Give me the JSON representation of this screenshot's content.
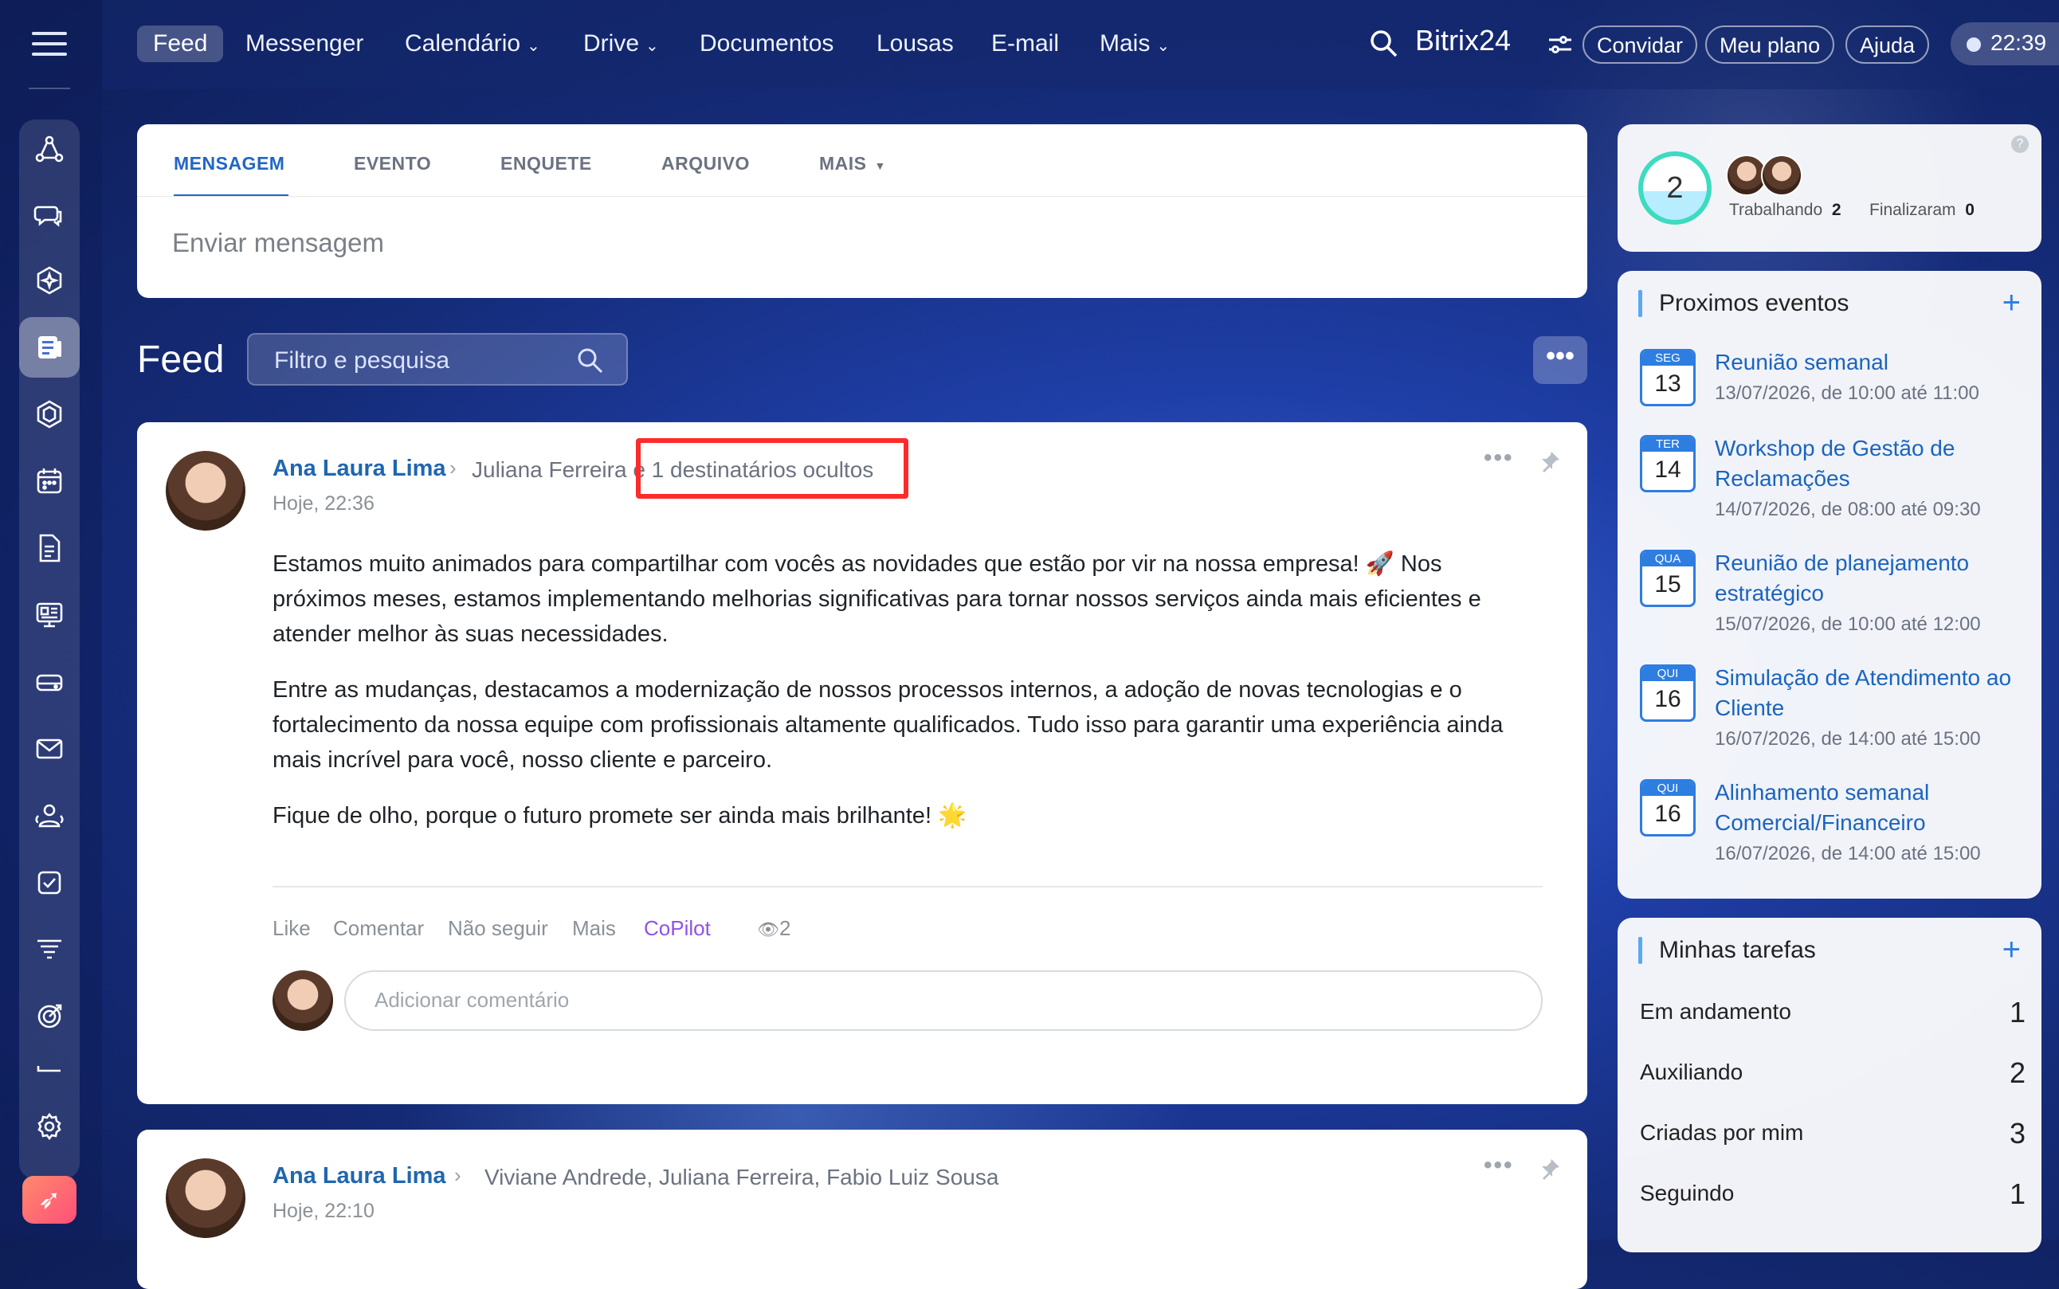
{
  "topbar": {
    "nav": [
      {
        "label": "Feed",
        "has_caret": false
      },
      {
        "label": "Messenger",
        "has_caret": false
      },
      {
        "label": "Calendário",
        "has_caret": true
      },
      {
        "label": "Drive",
        "has_caret": true
      },
      {
        "label": "Documentos",
        "has_caret": false
      },
      {
        "label": "Lousas",
        "has_caret": false
      },
      {
        "label": "E-mail",
        "has_caret": false
      },
      {
        "label": "Mais",
        "has_caret": true
      }
    ],
    "brand": "Bitrix24",
    "invite_label": "Convidar",
    "plan_label": "Meu plano",
    "help_label": "Ajuda",
    "clock": "22:39"
  },
  "composer": {
    "tabs": [
      "MENSAGEM",
      "EVENTO",
      "ENQUETE",
      "ARQUIVO",
      "MAIS"
    ],
    "active_tab": "MENSAGEM",
    "placeholder": "Enviar mensagem"
  },
  "feed": {
    "title": "Feed",
    "search_placeholder": "Filtro e pesquisa",
    "more_label": "•••"
  },
  "posts": [
    {
      "author": "Ana Laura Lima",
      "recipients": "Juliana Ferreira",
      "recipients_tail": "e",
      "hidden_recipients": "1 destinatários ocultos",
      "time": "Hoje, 22:36",
      "paragraphs": [
        "Estamos muito animados para compartilhar com vocês as novidades que estão por vir na nossa empresa! 🚀 Nos próximos meses, estamos implementando melhorias significativas para tornar nossos serviços ainda mais eficientes e atender melhor às suas necessidades.",
        "Entre as mudanças, destacamos a modernização de nossos processos internos, a adoção de novas tecnologias e o fortalecimento da nossa equipe com profissionais altamente qualificados. Tudo isso para garantir uma experiência ainda mais incrível para você, nosso cliente e parceiro.",
        "Fique de olho, porque o futuro promete ser ainda mais brilhante! 🌟"
      ],
      "actions": [
        "Like",
        "Comentar",
        "Não seguir",
        "Mais",
        "CoPilot"
      ],
      "views": "2",
      "comment_placeholder": "Adicionar comentário"
    },
    {
      "author": "Ana Laura Lima",
      "recipients": "Viviane Andrede, Juliana Ferreira, Fabio Luiz Sousa",
      "time": "Hoje, 22:10"
    }
  ],
  "worktime": {
    "count": "2",
    "working_label": "Trabalhando",
    "working_count": "2",
    "finished_label": "Finalizaram",
    "finished_count": "0",
    "help": "?"
  },
  "events": {
    "title": "Proximos eventos",
    "items": [
      {
        "dow": "SEG",
        "day": "13",
        "title": "Reunião semanal",
        "date": "13/07/2026, de 10:00 até 11:00"
      },
      {
        "dow": "TER",
        "day": "14",
        "title": "Workshop de Gestão de Reclamações",
        "date": "14/07/2026, de 08:00 até 09:30"
      },
      {
        "dow": "QUA",
        "day": "15",
        "title": "Reunião de planejamento estratégico",
        "date": "15/07/2026, de 10:00 até 12:00"
      },
      {
        "dow": "QUI",
        "day": "16",
        "title": "Simulação de Atendimento ao Cliente",
        "date": "16/07/2026, de 14:00 até 15:00"
      },
      {
        "dow": "QUI",
        "day": "16",
        "title": "Alinhamento semanal Comercial/Financeiro",
        "date": "16/07/2026, de 14:00 até 15:00"
      }
    ]
  },
  "tasks": {
    "title": "Minhas tarefas",
    "items": [
      {
        "label": "Em andamento",
        "count": "1"
      },
      {
        "label": "Auxiliando",
        "count": "2"
      },
      {
        "label": "Criadas por mim",
        "count": "3"
      },
      {
        "label": "Seguindo",
        "count": "1"
      }
    ]
  },
  "sidebar_icons": [
    "connect-icon",
    "chat-icon",
    "copilot-icon",
    "feed-icon",
    "workgroups-icon",
    "calendar-icon",
    "documents-icon",
    "boards-icon",
    "drive-icon",
    "mail-icon",
    "employees-icon",
    "tasks-icon",
    "crm-icon",
    "goals-icon",
    "more-icon",
    "settings-icon",
    "rocket-icon"
  ],
  "colors": {
    "accent": "#2266c4",
    "link": "#2066b0",
    "copilot": "#8e52ec",
    "highlight_box": "#ff2b2b"
  }
}
